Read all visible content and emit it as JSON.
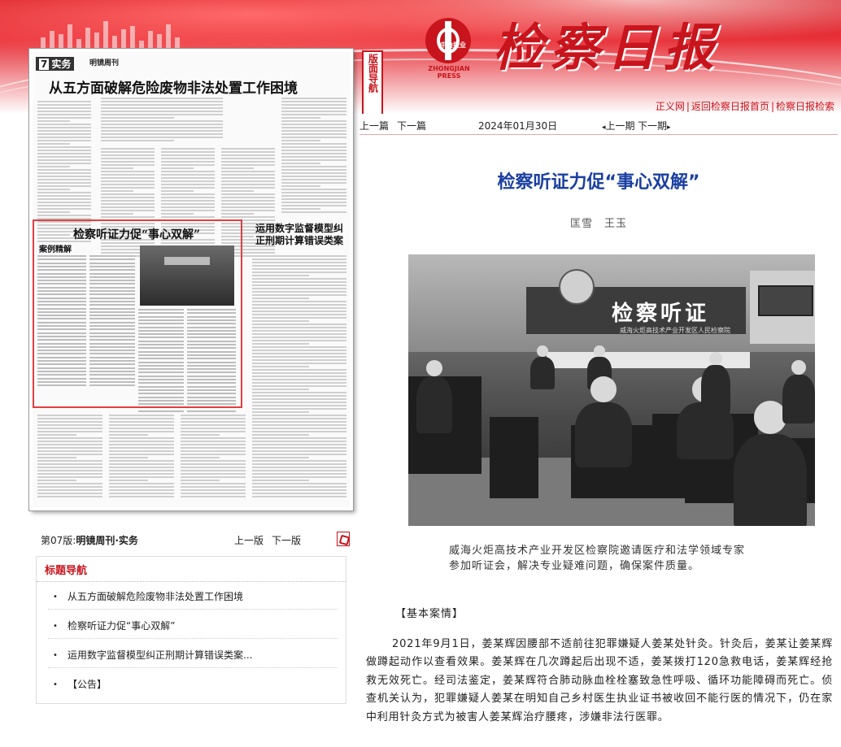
{
  "header": {
    "section_label": "版面导航",
    "logo_tag": "中检报业",
    "logo_press": "ZHONGJIAN PRESS",
    "masthead": "检察日报",
    "links": [
      "正义网",
      "返回检察日报首页",
      "检察日报检索"
    ]
  },
  "thumbnail": {
    "page_number": "7",
    "section": "实务",
    "column": "明镜周刊",
    "headline_top": "从五方面破解危险废物非法处置工作困境",
    "highlight_headline": "检察听证力促“事心双解”",
    "case_tag": "案例精解",
    "side_headline": "运用数字监督模型纠正刑期计算错误类案"
  },
  "page_nav": {
    "page_label": "第07版:",
    "page_name": "明镜周刊·实务",
    "prev": "上一版",
    "next": "下一版",
    "pdf_icon": "pdf-icon"
  },
  "toc": {
    "title": "标题导航",
    "items": [
      "从五方面破解危险废物非法处置工作困境",
      "检察听证力促“事心双解”",
      "运用数字监督模型纠正刑期计算错误类案...",
      "【公告】"
    ]
  },
  "article_nav": {
    "prev_article": "上一篇",
    "next_article": "下一篇",
    "date": "2024年01月30日",
    "prev_issue": "上一期",
    "next_issue": "下一期"
  },
  "article": {
    "title": "检察听证力促“事心双解”",
    "authors": "匡雪　王玉",
    "photo_sign": "检察听证",
    "photo_subsign": "威海火炬高技术产业开发区人民检察院",
    "caption": "威海火炬高技术产业开发区检察院邀请医疗和法学领域专家参加听证会，解决专业疑难问题，确保案件质量。",
    "section_heading": "【基本案情】",
    "paragraph": "2021年9月1日，姜某辉因腰部不适前往犯罪嫌疑人姜某处针灸。针灸后，姜某让姜某辉做蹲起动作以查看效果。姜某辉在几次蹲起后出现不适，姜某拨打120急救电话，姜某辉经抢救无效死亡。经司法鉴定，姜某辉符合肺动脉血栓栓塞致急性呼吸、循环功能障碍而死亡。侦查机关认为，犯罪嫌疑人姜某在明知自己乡村医生执业证书被收回不能行医的情况下，仍在家中利用针灸方式为被害人姜某辉治疗腰疼，涉嫌非法行医罪。"
  },
  "colors": {
    "brand_red": "#c8141c",
    "title_blue": "#1a3fa0"
  }
}
